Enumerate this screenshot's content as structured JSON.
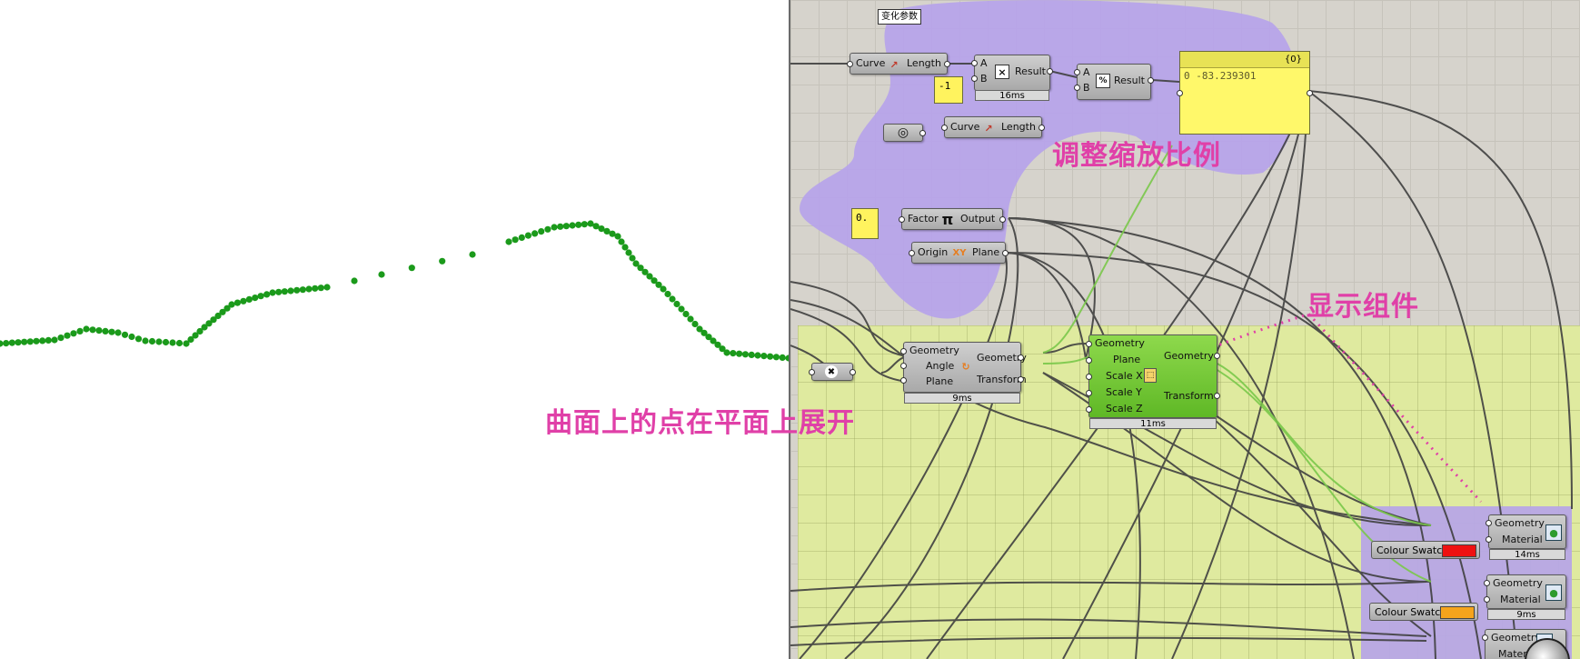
{
  "group_note": "变化参数",
  "annotations": {
    "scale": "调整缩放比例",
    "display": "显示组件",
    "unroll": "曲面上的点在平面上展开"
  },
  "length1": {
    "in": "Curve",
    "out": "Length"
  },
  "length2": {
    "in": "Curve",
    "out": "Length"
  },
  "multiply": {
    "a": "A",
    "b": "B",
    "out": "Result",
    "timer": "16ms"
  },
  "divide": {
    "a": "A",
    "b": "B",
    "out": "Result"
  },
  "slider_neg": {
    "value": "-1"
  },
  "slider_small": {
    "value": "0."
  },
  "panel": {
    "header": "{0}",
    "index": "0",
    "value": "-83.239301"
  },
  "pi": {
    "in": "Factor",
    "out": "Output"
  },
  "xy_plane": {
    "in": "Origin",
    "out": "Plane"
  },
  "rotate": {
    "in1": "Geometry",
    "in2": "Angle",
    "in3": "Plane",
    "out1": "Geometry",
    "out2": "Transform",
    "timer": "9ms"
  },
  "scale_nu": {
    "in1": "Geometry",
    "in2": "Plane",
    "in3": "Scale X",
    "in4": "Scale Y",
    "in5": "Scale Z",
    "out1": "Geometry",
    "out2": "Transform",
    "timer": "11ms"
  },
  "preview1": {
    "in1": "Geometry",
    "in2": "Material",
    "timer": "14ms"
  },
  "preview2": {
    "in1": "Geometry",
    "in2": "Material",
    "timer": "9ms"
  },
  "preview3": {
    "in1": "Geometry",
    "in2": "Material"
  },
  "swatch1": {
    "label": "Colour Swatch",
    "color": "#ee1111"
  },
  "swatch2": {
    "label": "Colour Swatch",
    "color": "#f5a41c"
  },
  "colors": {
    "points": "#1b9a1b",
    "purple_group": "#b6a3ea",
    "green_group": "#dfea9f",
    "annotation": "#e040a8"
  }
}
